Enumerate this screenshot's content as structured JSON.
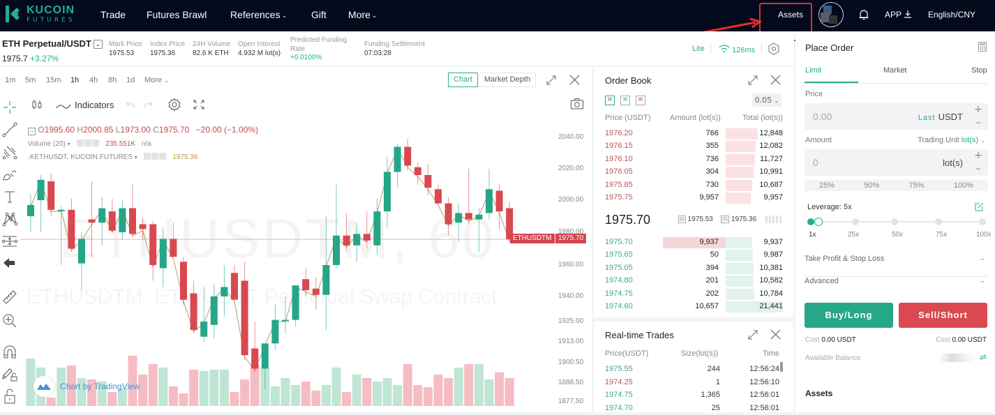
{
  "nav": {
    "logo_line1": "KUCOIN",
    "logo_line2": "FUTURES",
    "items": [
      {
        "label": "Trade",
        "dropdown": false
      },
      {
        "label": "Futures Brawl",
        "dropdown": false
      },
      {
        "label": "References",
        "dropdown": true
      },
      {
        "label": "Gift",
        "dropdown": false
      },
      {
        "label": "More",
        "dropdown": true
      }
    ],
    "assets": "Assets",
    "app": "APP",
    "language": "English/CNY"
  },
  "ticker": {
    "symbol": "ETH Perpetual/USDT",
    "last_price": "1975.7",
    "change": "+3.27%",
    "stats": [
      {
        "key": "Mark Price",
        "value": "1975.53"
      },
      {
        "key": "Index Price",
        "value": "1975.36"
      },
      {
        "key": "24H Volume",
        "value": "82.6 K ETH"
      },
      {
        "key": "Open Interest",
        "value": "4.932 M lot(s)"
      },
      {
        "key": "Predicted Funding Rate",
        "value": "+0.0100%"
      },
      {
        "key": "Funding Settlement",
        "value": "07:03:28"
      }
    ],
    "mode": "Lite",
    "latency": "126ms"
  },
  "chart": {
    "timeframes": [
      "1m",
      "5m",
      "15m",
      "1h",
      "4h",
      "8h",
      "1d",
      "More"
    ],
    "active_timeframe": "1h",
    "view_tabs": [
      "Chart",
      "Market Depth"
    ],
    "active_view": "Chart",
    "indicators_label": "Indicators",
    "ohlc": {
      "o": "1995.60",
      "h": "2000.85",
      "l": "1973.00",
      "c": "1975.70",
      "change": "−20.00 (−1.00%)"
    },
    "volume_label": "Volume (20)",
    "volume_value": "235.551K",
    "volume_na": "n/a",
    "index_label": ".KETHUSDT, KUCOIN FUTURES",
    "index_value": "1975.36",
    "watermark_symbol": "ETHUSDTM, 60",
    "watermark_desc": "ETHUSDTM: ETH/USDT Perpetual Swap Contract",
    "price_tag_symbol": "ETHUSDTM",
    "price_tag_value": "1975.70",
    "y_ticks": [
      "2040.00",
      "2020.00",
      "2000.00",
      "1980.00",
      "1960.00",
      "1940.00",
      "1925.00",
      "1913.00",
      "1900.50",
      "1888.50",
      "1877.50"
    ],
    "tradingview": "Chart by TradingView",
    "colors": {
      "up": "#26a688",
      "down": "#d9484f",
      "vol_up": "#bfe5d5",
      "vol_down": "#f6bcc3"
    }
  },
  "chart_data": {
    "type": "candlestick",
    "title": "ETHUSDTM, 60",
    "ylim": [
      1870,
      2045
    ],
    "y_ticks": [
      2040,
      2020,
      2000,
      1980,
      1960,
      1940,
      1925,
      1913,
      1900.5,
      1888.5,
      1877.5
    ],
    "last": 1975.7,
    "candles": [
      [
        1990,
        2004,
        1980,
        1997
      ],
      [
        2000,
        2016,
        1980,
        2013
      ],
      [
        2012,
        2017,
        1990,
        1994
      ],
      [
        1994,
        1996,
        1960,
        1994
      ],
      [
        1994,
        2001,
        1968,
        1970
      ],
      [
        1961,
        1980,
        1944,
        1976
      ],
      [
        1988,
        2012,
        1965,
        1986
      ],
      [
        1986,
        2002,
        1972,
        1995
      ],
      [
        1993,
        2001,
        1980,
        1981
      ],
      [
        1980,
        2000,
        1975,
        1995
      ],
      [
        1995,
        2010,
        1977,
        1979
      ],
      [
        1985,
        1989,
        1975,
        1982
      ],
      [
        1985,
        1987,
        1950,
        1960
      ],
      [
        1958,
        1983,
        1946,
        1976
      ],
      [
        1976,
        1986,
        1966,
        1965
      ],
      [
        1962,
        1965,
        1935,
        1938
      ],
      [
        1942,
        1950,
        1918,
        1920
      ],
      [
        1916,
        1946,
        1913,
        1925
      ],
      [
        1923,
        1948,
        1915,
        1940
      ],
      [
        1940,
        1960,
        1928,
        1946
      ],
      [
        1955,
        1960,
        1939,
        1938
      ],
      [
        1950,
        1962,
        1902,
        1905
      ],
      [
        1909,
        1925,
        1895,
        1897
      ],
      [
        1897,
        1912,
        1885,
        1912
      ],
      [
        1912,
        1935,
        1908,
        1926
      ],
      [
        1926,
        1940,
        1918,
        1926
      ],
      [
        1926,
        1947,
        1922,
        1947
      ],
      [
        1951,
        1958,
        1940,
        1944
      ],
      [
        1945,
        1952,
        1932,
        1941
      ],
      [
        1941,
        1990,
        1920,
        1960
      ],
      [
        1960,
        2010,
        1958,
        1978
      ],
      [
        1978,
        1992,
        1968,
        1972
      ],
      [
        1972,
        1986,
        1962,
        1979
      ],
      [
        1979,
        1993,
        1970,
        1975
      ],
      [
        1972,
        2001,
        1966,
        1993
      ],
      [
        1993,
        2028,
        1983,
        2018
      ],
      [
        2018,
        2036,
        2008,
        2034
      ],
      [
        2034,
        2039,
        2019,
        2022
      ],
      [
        2021,
        2024,
        2010,
        2016
      ],
      [
        2016,
        2023,
        2003,
        2008
      ],
      [
        2007,
        2010,
        1997,
        1998
      ],
      [
        1998,
        2002,
        1978,
        1985
      ],
      [
        1986,
        1998,
        1974,
        1992
      ],
      [
        1992,
        2020,
        1985,
        1988
      ],
      [
        1988,
        1995,
        1968,
        1991
      ],
      [
        1992,
        2020,
        1988,
        2007
      ],
      [
        2006,
        2010,
        1982,
        1993
      ],
      [
        1995,
        1999,
        1974,
        1975.7
      ]
    ],
    "volume_direction": "alternating up/down per candle"
  },
  "orderbook": {
    "title": "Order Book",
    "depth": "0.05",
    "headers": [
      "Price (USDT)",
      "Amount (lot(s))",
      "Total (lot(s))"
    ],
    "asks": [
      {
        "price": "1976.20",
        "amount": "766",
        "total": "12,848",
        "fill": 1.0
      },
      {
        "price": "1976.15",
        "amount": "355",
        "total": "12,082",
        "fill": 0.94
      },
      {
        "price": "1976.10",
        "amount": "736",
        "total": "11,727",
        "fill": 0.91
      },
      {
        "price": "1976.05",
        "amount": "304",
        "total": "10,991",
        "fill": 0.86
      },
      {
        "price": "1975.85",
        "amount": "730",
        "total": "10,687",
        "fill": 0.83
      },
      {
        "price": "1975.75",
        "amount": "9,957",
        "total": "9,957",
        "fill": 0.78
      }
    ],
    "mid_price": "1975.70",
    "mark_label": "M",
    "mark": "1975.53",
    "index_label": "IN",
    "index": "1975.36",
    "bids": [
      {
        "price": "1975.70",
        "amount": "9,937",
        "total": "9,937",
        "fill": 0.46
      },
      {
        "price": "1975.65",
        "amount": "50",
        "total": "9,987",
        "fill": 0.47
      },
      {
        "price": "1975.05",
        "amount": "394",
        "total": "10,381",
        "fill": 0.48
      },
      {
        "price": "1974.80",
        "amount": "201",
        "total": "10,582",
        "fill": 0.49
      },
      {
        "price": "1974.75",
        "amount": "202",
        "total": "10,784",
        "fill": 0.5
      },
      {
        "price": "1974.60",
        "amount": "10,657",
        "total": "21,441",
        "fill": 1.0
      }
    ]
  },
  "trades": {
    "title": "Real-time Trades",
    "headers": [
      "Price(USDT)",
      "Size(lot(s))",
      "Time"
    ],
    "rows": [
      {
        "price": "1975.55",
        "size": "244",
        "time": "12:56:24",
        "side": "buy"
      },
      {
        "price": "1974.25",
        "size": "1",
        "time": "12:56:10",
        "side": "sell"
      },
      {
        "price": "1974.75",
        "size": "1,365",
        "time": "12:56:01",
        "side": "buy"
      },
      {
        "price": "1974.70",
        "size": "25",
        "time": "12:56:01",
        "side": "buy"
      }
    ]
  },
  "order": {
    "title": "Place Order",
    "tabs": [
      "Limit",
      "Market",
      "Stop"
    ],
    "active_tab": "Limit",
    "price_label": "Price",
    "price_value": "0.00",
    "price_last": "Last",
    "price_unit": "USDT",
    "amount_label": "Amount",
    "trading_unit_label": "Trading Unit",
    "trading_unit_value": "lot(s)",
    "amount_value": "0",
    "amount_unit": "lot(s)",
    "percents": [
      "25%",
      "50%",
      "75%",
      "100%"
    ],
    "leverage_label": "Leverage: 5x",
    "leverage_value": 5,
    "leverage_ticks": [
      "1x",
      "25x",
      "50x",
      "75x",
      "100x"
    ],
    "tpsl": "Take Profit & Stop Loss",
    "advanced": "Advanced",
    "buy": "Buy/Long",
    "sell": "Sell/Short",
    "cost_label": "Cost",
    "buy_cost": "0.00 USDT",
    "sell_cost": "0.00 USDT",
    "available": "Available Balance",
    "assets": "Assets",
    "colors": {
      "buy": "#27a78a",
      "sell": "#d9494f"
    }
  }
}
